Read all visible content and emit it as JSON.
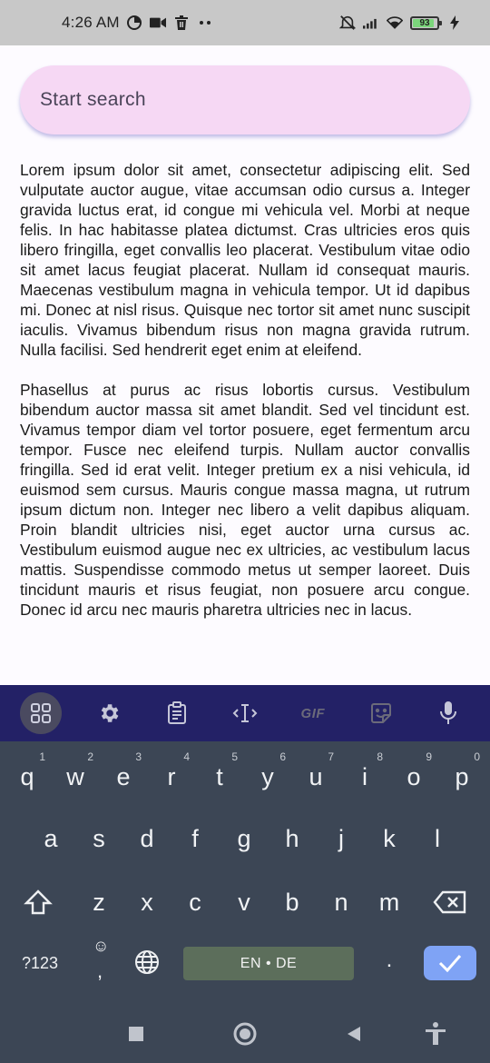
{
  "status_bar": {
    "time": "4:26 AM",
    "battery_level": "93",
    "left_icons": [
      "data-saver-icon",
      "video-icon",
      "trash-icon",
      "more-dots-icon"
    ],
    "right_icons": [
      "mute-icon",
      "signal-icon",
      "wifi-icon",
      "battery-icon",
      "charging-icon"
    ]
  },
  "search": {
    "placeholder": "Start search"
  },
  "content": {
    "paragraphs": [
      "Lorem ipsum dolor sit amet, consectetur adipiscing elit. Sed vulputate auctor augue, vitae accumsan odio cursus a. Integer gravida luctus erat, id congue mi vehicula vel. Morbi at neque felis. In hac habitasse platea dictumst. Cras ultricies eros quis libero fringilla, eget convallis leo placerat. Vestibulum vitae odio sit amet lacus feugiat placerat. Nullam id consequat mauris. Maecenas vestibulum magna in vehicula tempor. Ut id dapibus mi. Donec at nisl risus. Quisque nec tortor sit amet nunc suscipit iaculis. Vivamus bibendum risus non magna gravida rutrum. Nulla facilisi. Sed hendrerit eget enim at eleifend.",
      "Phasellus at purus ac risus lobortis cursus. Vestibulum bibendum auctor massa sit amet blandit. Sed vel tincidunt est. Vivamus tempor diam vel tortor posuere, eget fermentum arcu tempor. Fusce nec eleifend turpis. Nullam auctor convallis fringilla. Sed id erat velit. Integer pretium ex a nisi vehicula, id euismod sem cursus. Mauris congue massa magna, ut rutrum ipsum dictum non. Integer nec libero a velit dapibus aliquam. Proin blandit ultricies nisi, eget auctor urna cursus ac. Vestibulum euismod augue nec ex ultricies, ac vestibulum lacus mattis. Suspendisse commodo metus ut semper laoreet. Duis tincidunt mauris et risus feugiat, non posuere arcu congue. Donec id arcu nec mauris pharetra ultricies nec in lacus."
    ]
  },
  "keyboard": {
    "toolbar": {
      "items": [
        "apps-grid-icon",
        "settings-icon",
        "clipboard-icon",
        "cursor-control-icon",
        "gif-icon",
        "sticker-icon",
        "mic-icon"
      ],
      "gif_label": "GIF"
    },
    "row1": [
      {
        "char": "q",
        "hint": "1"
      },
      {
        "char": "w",
        "hint": "2"
      },
      {
        "char": "e",
        "hint": "3"
      },
      {
        "char": "r",
        "hint": "4"
      },
      {
        "char": "t",
        "hint": "5"
      },
      {
        "char": "y",
        "hint": "6"
      },
      {
        "char": "u",
        "hint": "7"
      },
      {
        "char": "i",
        "hint": "8"
      },
      {
        "char": "o",
        "hint": "9"
      },
      {
        "char": "p",
        "hint": "0"
      }
    ],
    "row2": [
      "a",
      "s",
      "d",
      "f",
      "g",
      "h",
      "j",
      "k",
      "l"
    ],
    "row3": [
      "z",
      "x",
      "c",
      "v",
      "b",
      "n",
      "m"
    ],
    "symbols_label": "?123",
    "comma_label": ",",
    "period_label": ".",
    "space_label": "EN • DE"
  },
  "colors": {
    "search_bg": "#f6d8f4",
    "toolbar_bg": "#232166",
    "keyboard_bg": "#3c4655",
    "space_bg": "#5c6e5b",
    "enter_bg": "#7fa3f5"
  }
}
